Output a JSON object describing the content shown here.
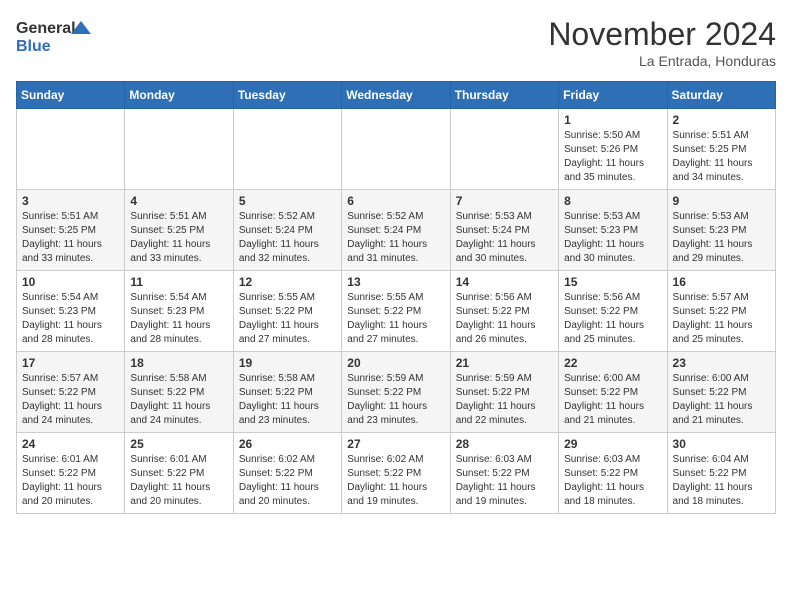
{
  "header": {
    "logo_line1": "General",
    "logo_line2": "Blue",
    "month": "November 2024",
    "location": "La Entrada, Honduras"
  },
  "days_of_week": [
    "Sunday",
    "Monday",
    "Tuesday",
    "Wednesday",
    "Thursday",
    "Friday",
    "Saturday"
  ],
  "weeks": [
    [
      {
        "num": "",
        "info": ""
      },
      {
        "num": "",
        "info": ""
      },
      {
        "num": "",
        "info": ""
      },
      {
        "num": "",
        "info": ""
      },
      {
        "num": "",
        "info": ""
      },
      {
        "num": "1",
        "info": "Sunrise: 5:50 AM\nSunset: 5:26 PM\nDaylight: 11 hours and 35 minutes."
      },
      {
        "num": "2",
        "info": "Sunrise: 5:51 AM\nSunset: 5:25 PM\nDaylight: 11 hours and 34 minutes."
      }
    ],
    [
      {
        "num": "3",
        "info": "Sunrise: 5:51 AM\nSunset: 5:25 PM\nDaylight: 11 hours and 33 minutes."
      },
      {
        "num": "4",
        "info": "Sunrise: 5:51 AM\nSunset: 5:25 PM\nDaylight: 11 hours and 33 minutes."
      },
      {
        "num": "5",
        "info": "Sunrise: 5:52 AM\nSunset: 5:24 PM\nDaylight: 11 hours and 32 minutes."
      },
      {
        "num": "6",
        "info": "Sunrise: 5:52 AM\nSunset: 5:24 PM\nDaylight: 11 hours and 31 minutes."
      },
      {
        "num": "7",
        "info": "Sunrise: 5:53 AM\nSunset: 5:24 PM\nDaylight: 11 hours and 30 minutes."
      },
      {
        "num": "8",
        "info": "Sunrise: 5:53 AM\nSunset: 5:23 PM\nDaylight: 11 hours and 30 minutes."
      },
      {
        "num": "9",
        "info": "Sunrise: 5:53 AM\nSunset: 5:23 PM\nDaylight: 11 hours and 29 minutes."
      }
    ],
    [
      {
        "num": "10",
        "info": "Sunrise: 5:54 AM\nSunset: 5:23 PM\nDaylight: 11 hours and 28 minutes."
      },
      {
        "num": "11",
        "info": "Sunrise: 5:54 AM\nSunset: 5:23 PM\nDaylight: 11 hours and 28 minutes."
      },
      {
        "num": "12",
        "info": "Sunrise: 5:55 AM\nSunset: 5:22 PM\nDaylight: 11 hours and 27 minutes."
      },
      {
        "num": "13",
        "info": "Sunrise: 5:55 AM\nSunset: 5:22 PM\nDaylight: 11 hours and 27 minutes."
      },
      {
        "num": "14",
        "info": "Sunrise: 5:56 AM\nSunset: 5:22 PM\nDaylight: 11 hours and 26 minutes."
      },
      {
        "num": "15",
        "info": "Sunrise: 5:56 AM\nSunset: 5:22 PM\nDaylight: 11 hours and 25 minutes."
      },
      {
        "num": "16",
        "info": "Sunrise: 5:57 AM\nSunset: 5:22 PM\nDaylight: 11 hours and 25 minutes."
      }
    ],
    [
      {
        "num": "17",
        "info": "Sunrise: 5:57 AM\nSunset: 5:22 PM\nDaylight: 11 hours and 24 minutes."
      },
      {
        "num": "18",
        "info": "Sunrise: 5:58 AM\nSunset: 5:22 PM\nDaylight: 11 hours and 24 minutes."
      },
      {
        "num": "19",
        "info": "Sunrise: 5:58 AM\nSunset: 5:22 PM\nDaylight: 11 hours and 23 minutes."
      },
      {
        "num": "20",
        "info": "Sunrise: 5:59 AM\nSunset: 5:22 PM\nDaylight: 11 hours and 23 minutes."
      },
      {
        "num": "21",
        "info": "Sunrise: 5:59 AM\nSunset: 5:22 PM\nDaylight: 11 hours and 22 minutes."
      },
      {
        "num": "22",
        "info": "Sunrise: 6:00 AM\nSunset: 5:22 PM\nDaylight: 11 hours and 21 minutes."
      },
      {
        "num": "23",
        "info": "Sunrise: 6:00 AM\nSunset: 5:22 PM\nDaylight: 11 hours and 21 minutes."
      }
    ],
    [
      {
        "num": "24",
        "info": "Sunrise: 6:01 AM\nSunset: 5:22 PM\nDaylight: 11 hours and 20 minutes."
      },
      {
        "num": "25",
        "info": "Sunrise: 6:01 AM\nSunset: 5:22 PM\nDaylight: 11 hours and 20 minutes."
      },
      {
        "num": "26",
        "info": "Sunrise: 6:02 AM\nSunset: 5:22 PM\nDaylight: 11 hours and 20 minutes."
      },
      {
        "num": "27",
        "info": "Sunrise: 6:02 AM\nSunset: 5:22 PM\nDaylight: 11 hours and 19 minutes."
      },
      {
        "num": "28",
        "info": "Sunrise: 6:03 AM\nSunset: 5:22 PM\nDaylight: 11 hours and 19 minutes."
      },
      {
        "num": "29",
        "info": "Sunrise: 6:03 AM\nSunset: 5:22 PM\nDaylight: 11 hours and 18 minutes."
      },
      {
        "num": "30",
        "info": "Sunrise: 6:04 AM\nSunset: 5:22 PM\nDaylight: 11 hours and 18 minutes."
      }
    ]
  ]
}
